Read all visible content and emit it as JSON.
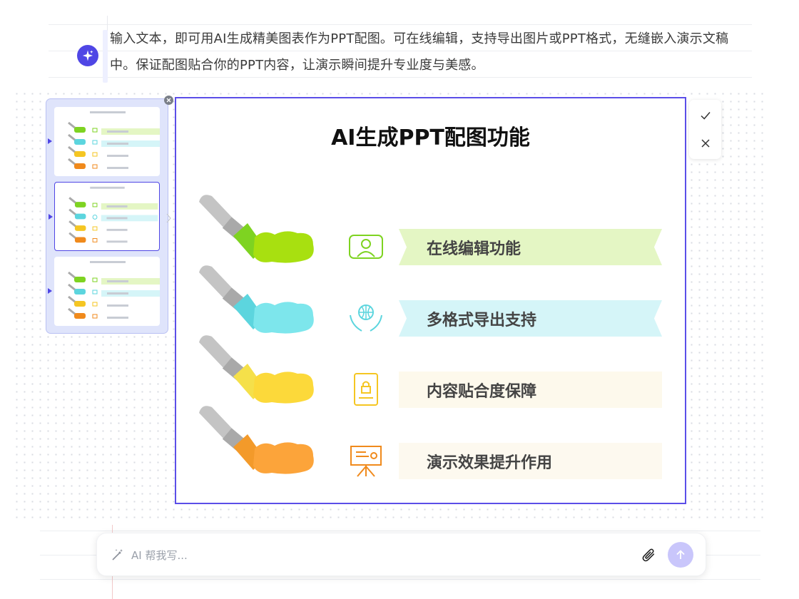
{
  "prompt": {
    "text": "输入文本，即可用AI生成精美图表作为PPT配图。可在线编辑，支持导出图片或PPT格式，无缝嵌入演示文稿中。保证配图贴合你的PPT内容，让演示瞬间提升专业度与美感。"
  },
  "slide": {
    "title": "AI生成PPT配图功能",
    "features": [
      {
        "label": "在线编辑功能",
        "icon": "user-profile-icon",
        "color": "#7ed321",
        "band": "#e4f6c4"
      },
      {
        "label": "多格式导出支持",
        "icon": "globe-hands-icon",
        "color": "#5cd5de",
        "band": "#d5f5f8"
      },
      {
        "label": "内容贴合度保障",
        "icon": "document-lock-icon",
        "color": "#f5c622",
        "band": "#fdf9ec"
      },
      {
        "label": "演示效果提升作用",
        "icon": "presentation-board-icon",
        "color": "#f08a1c",
        "band": "#fdf9ef"
      }
    ]
  },
  "thumbnails": {
    "count": 3,
    "selected_index": 1
  },
  "composer": {
    "placeholder": "AI 帮我写..."
  },
  "colors": {
    "accent": "#4f46e5",
    "green": "#7ed321",
    "cyan": "#7de6ec",
    "yellow": "#fcd93a",
    "orange": "#fca43a"
  }
}
